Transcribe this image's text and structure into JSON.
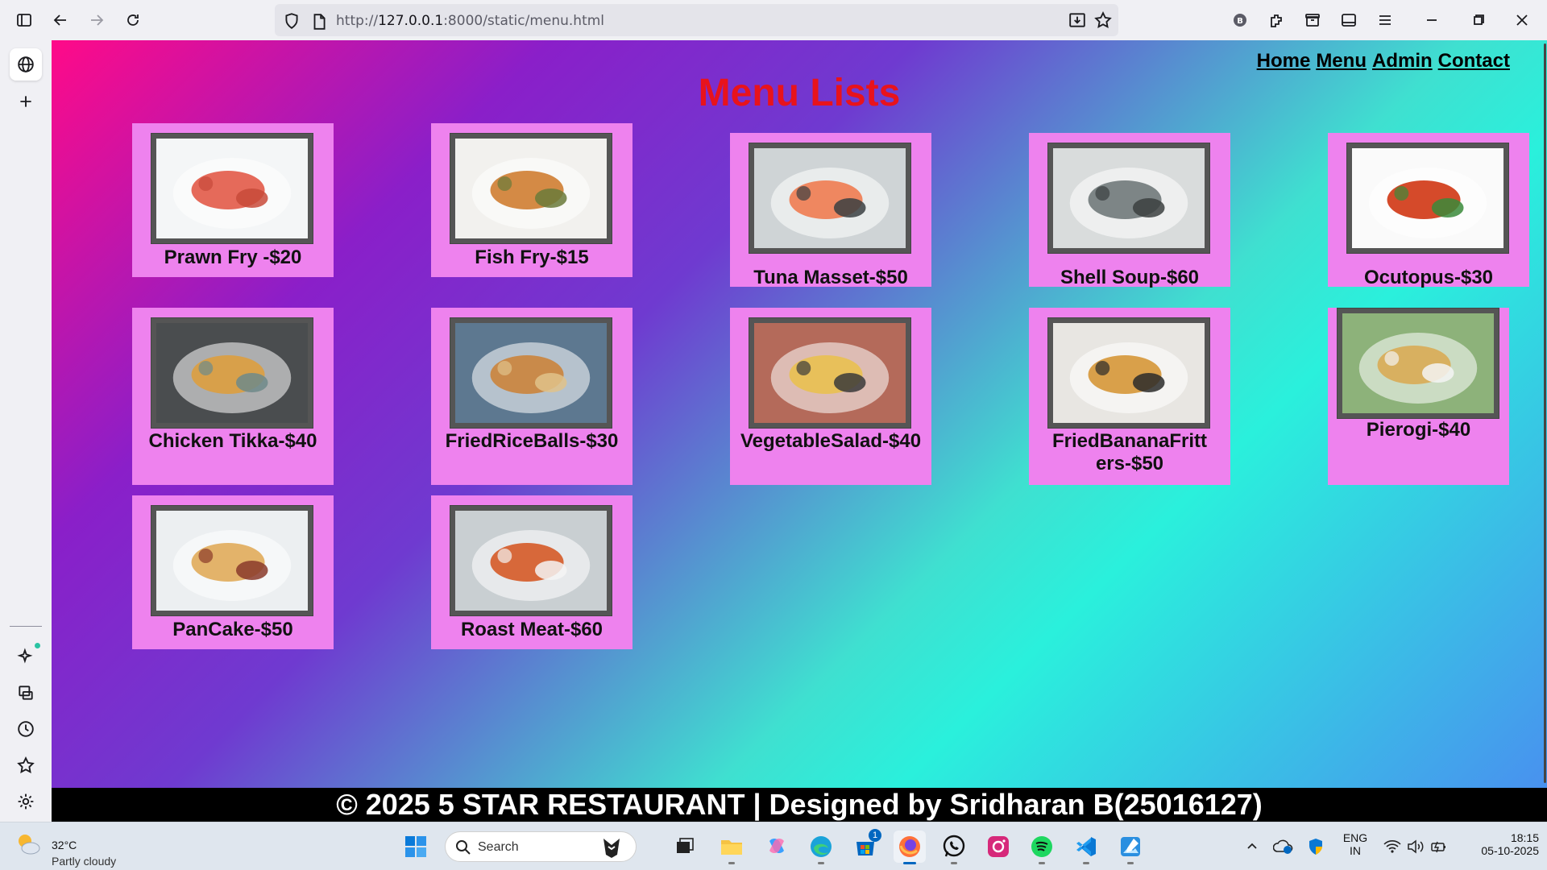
{
  "browser": {
    "url_prefix": "http://",
    "url_host": "127.0.0.1",
    "url_path": ":8000/static/menu.html"
  },
  "page": {
    "nav": [
      "Home",
      "Menu",
      "Admin",
      "Contact"
    ],
    "title": "Menu Lists",
    "items": [
      {
        "label": "Prawn Fry -$20",
        "colors": [
          "#f4f6f7",
          "#e56a5a",
          "#c84a3a"
        ]
      },
      {
        "label": "Fish Fry-$15",
        "colors": [
          "#f2f1ee",
          "#d48a45",
          "#6a7a3a"
        ]
      },
      {
        "label": "Tuna Masset-$50",
        "colors": [
          "#cfd4d6",
          "#ef8760",
          "#3a3f42"
        ]
      },
      {
        "label": "Shell Soup-$60",
        "colors": [
          "#d9dcdc",
          "#7d8586",
          "#3b3f40"
        ]
      },
      {
        "label": "Ocutopus-$30",
        "colors": [
          "#fafafa",
          "#d54a2a",
          "#3a8a3a"
        ]
      },
      {
        "label": "Chicken Tikka-$40",
        "colors": [
          "#4a4d4f",
          "#d8a04a",
          "#6e8a8a"
        ]
      },
      {
        "label": "FriedRiceBalls-$30",
        "colors": [
          "#5d7890",
          "#c98a4a",
          "#e0c28a"
        ]
      },
      {
        "label": "VegetableSalad-$40",
        "colors": [
          "#b46a5a",
          "#e8c05a",
          "#3a3a3a"
        ]
      },
      {
        "label": "FriedBananaFritters-$50",
        "colors": [
          "#e8e6e2",
          "#d9a04a",
          "#2a2a2a"
        ]
      },
      {
        "label": "Pierogi-$40",
        "colors": [
          "#8db27a",
          "#d8b060",
          "#f4f4f4"
        ]
      },
      {
        "label": "PanCake-$50",
        "colors": [
          "#eceff1",
          "#e3b36a",
          "#8a3a2a"
        ]
      },
      {
        "label": "Roast Meat-$60",
        "colors": [
          "#c9cfd2",
          "#d7683a",
          "#f4f4f4"
        ]
      }
    ],
    "footer": "© 2025 5 STAR RESTAURANT | Designed by Sridharan B(25016127)"
  },
  "taskbar": {
    "weather_temp": "32°C",
    "weather_desc": "Partly cloudy",
    "search_label": "Search",
    "store_badge": "1",
    "lang_top": "ENG",
    "lang_bottom": "IN",
    "time": "18:15",
    "date": "05-10-2025"
  }
}
